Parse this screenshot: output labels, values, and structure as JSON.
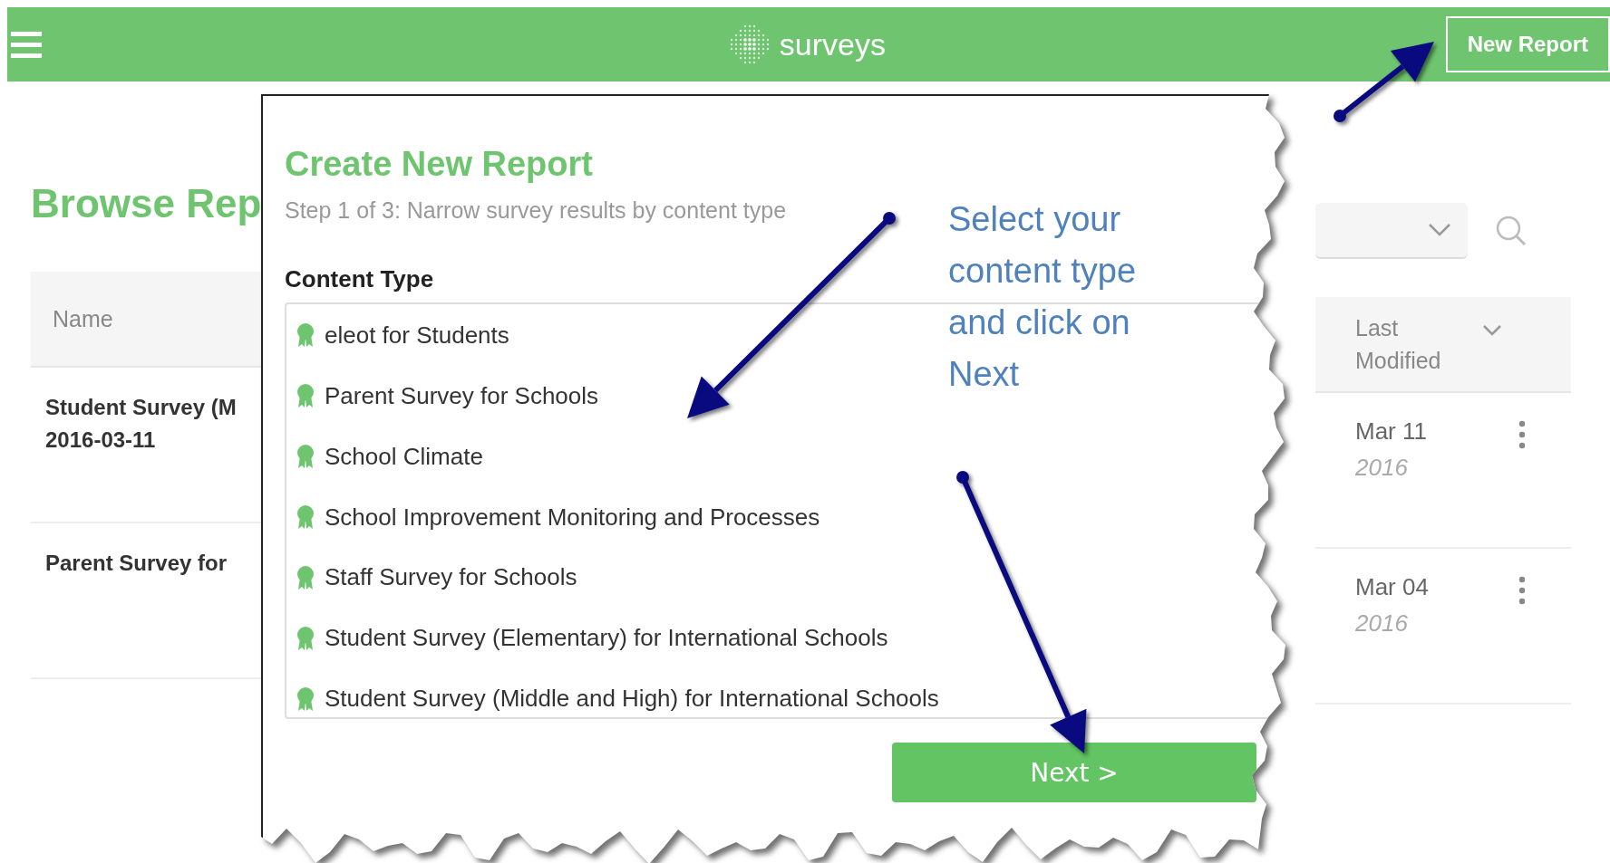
{
  "header": {
    "logo_text": "surveys",
    "new_report_button": "New Report"
  },
  "page": {
    "title": "Browse Rep",
    "table": {
      "columns": [
        "Name",
        "Last Modified"
      ],
      "rows": [
        {
          "name": [
            "Student Survey (M",
            "2016-03-11"
          ],
          "date": "Mar 11",
          "year": "2016"
        },
        {
          "name": [
            "Parent Survey for"
          ],
          "date": "Mar 04",
          "year": "2016"
        }
      ]
    }
  },
  "dialog": {
    "title": "Create New Report",
    "step": "Step 1 of 3: Narrow survey results by content type",
    "field_label": "Content Type",
    "content_types": [
      "eleot for Students",
      "Parent Survey for Schools",
      "School Climate",
      "School Improvement Monitoring and Processes",
      "Staff Survey for Schools",
      "Student Survey (Elementary) for International Schools",
      "Student Survey (Middle and High) for International Schools"
    ],
    "next_button": "Next >"
  },
  "callout": "Select your content type and click on Next"
}
